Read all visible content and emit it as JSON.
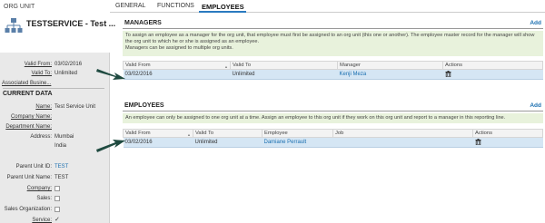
{
  "left_panel": {
    "header_title": "ORG UNIT",
    "org_name": "TESTSERVICE - Test ...",
    "valid_from_label": "Valid From:",
    "valid_from_value": "03/02/2016",
    "valid_to_label": "Valid To:",
    "valid_to_value": "Unlimited",
    "associated_business": "Associated Busine...",
    "current_data_title": "CURRENT DATA",
    "name_label": "Name:",
    "name_value": "Test Service Unit",
    "company_name_label": "Company Name:",
    "department_name_label": "Department Name:",
    "address_label": "Address:",
    "address_line1": "Mumbai",
    "address_line2": "India",
    "parent_unit_id_label": "Parent Unit ID:",
    "parent_unit_id_value": "TEST",
    "parent_unit_name_label": "Parent Unit Name:",
    "parent_unit_name_value": "TEST",
    "company_label": "Company:",
    "sales_label": "Sales:",
    "sales_org_label": "Sales Organization:",
    "service_label": "Service:"
  },
  "tabs": [
    "GENERAL",
    "FUNCTIONS",
    "EMPLOYEES"
  ],
  "managers": {
    "title": "MANAGERS",
    "add_label": "Add",
    "note": "To assign an employee as a manager for the org unit, that employee must first be assigned to an org unit (this one or another). The employee master record for the manager will show the org unit to which he or she is assigned as an employee.\nManagers can be assigned to multiple org units.",
    "columns": [
      "Valid From",
      "Valid To",
      "Manager",
      "Actions"
    ],
    "rows": [
      {
        "valid_from": "03/02/2016",
        "valid_to": "Unlimited",
        "manager": "Kenji Meza"
      }
    ]
  },
  "employees": {
    "title": "EMPLOYEES",
    "add_label": "Add",
    "note": "An employee can only be assigned to one org unit at a time.  Assign an employee to this org unit if they work on this org unit and report to a manager in this reporting line.",
    "columns": [
      "Valid From",
      "Valid To",
      "Employee",
      "Job",
      "Actions"
    ],
    "rows": [
      {
        "valid_from": "03/02/2016",
        "valid_to": "Unlimited",
        "employee": "Damiane Perrault",
        "job": ""
      }
    ]
  },
  "colors": {
    "accent": "#1a6fb0",
    "row_highlight": "#d5e6f4",
    "note_bg": "#e8f2dc",
    "arrow": "#1f4a40"
  }
}
